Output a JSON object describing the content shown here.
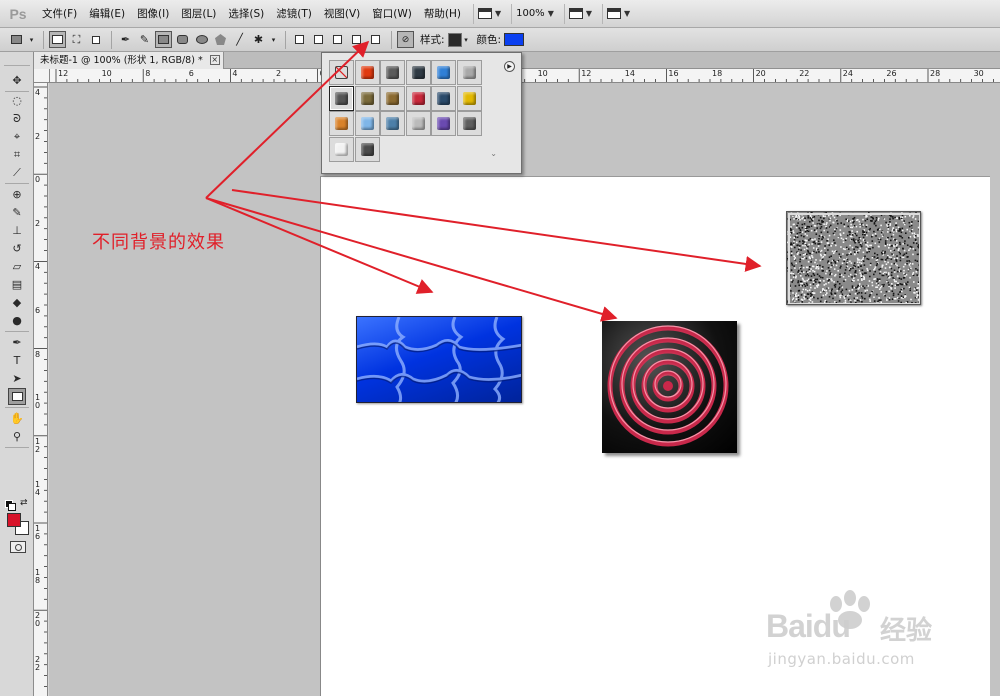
{
  "app": {
    "logo": "Ps"
  },
  "menu": [
    "文件(F)",
    "编辑(E)",
    "图像(I)",
    "图层(L)",
    "选择(S)",
    "滤镜(T)",
    "视图(V)",
    "窗口(W)",
    "帮助(H)"
  ],
  "menubar_controls": {
    "zoom": "100%"
  },
  "options_bar": {
    "style_label": "样式:",
    "color_label": "颜色:",
    "fill_color": "#0a3ff0",
    "style_swatch_color": "#2a2a2a"
  },
  "document_tab": {
    "title": "未标题-1 @ 100% (形状 1, RGB/8) *",
    "close": "×"
  },
  "ruler_top_labels": [
    "12",
    "10",
    "8",
    "6",
    "4",
    "2",
    "0",
    "2",
    "4",
    "6",
    "8",
    "10",
    "12",
    "14",
    "16",
    "18",
    "20",
    "22",
    "24",
    "26",
    "28",
    "30"
  ],
  "ruler_left_labels": [
    "4",
    "2",
    "0",
    "2",
    "4",
    "6",
    "8",
    "1 0",
    "1 2",
    "1 4",
    "1 6",
    "1 8",
    "2 0",
    "2 2"
  ],
  "tools": {
    "foreground_color": "#d8132a",
    "background_color": "#ffffff",
    "items": [
      "move-icon",
      "marquee-icon",
      "lasso-icon",
      "quick-select-icon",
      "crop-icon",
      "eyedropper-icon",
      "healing-brush-icon",
      "brush-icon",
      "clone-stamp-icon",
      "history-brush-icon",
      "eraser-icon",
      "gradient-icon",
      "blur-icon",
      "dodge-icon",
      "pen-icon",
      "type-icon",
      "path-select-icon",
      "rectangle-icon",
      "hand-icon",
      "zoom-icon"
    ]
  },
  "style_panel": {
    "swatches": [
      {
        "name": "none",
        "color": "transparent"
      },
      {
        "name": "red-glow",
        "color": "#e03a10"
      },
      {
        "name": "gray-bevel",
        "color": "#5a5a5a"
      },
      {
        "name": "dark-sphere",
        "color": "#2f3a44"
      },
      {
        "name": "blue-glass",
        "color": "#2f7fd6"
      },
      {
        "name": "light-gray",
        "color": "#a8a8a8"
      },
      {
        "name": "metal-gradient",
        "color": "#555555"
      },
      {
        "name": "bronze",
        "color": "#7a6a3a"
      },
      {
        "name": "gold-brown",
        "color": "#8b6a30"
      },
      {
        "name": "red-plastic",
        "color": "#c8283a"
      },
      {
        "name": "multicolor",
        "color": "#2a4a6a"
      },
      {
        "name": "yellow-gold",
        "color": "#e2b800"
      },
      {
        "name": "orange-sunset",
        "color": "#d9822a"
      },
      {
        "name": "sky-blue",
        "color": "#7fb6e8"
      },
      {
        "name": "landscape",
        "color": "#4d7fa8"
      },
      {
        "name": "frame-gray",
        "color": "#bbbbbb"
      },
      {
        "name": "purple-glass",
        "color": "#6a4ab0"
      },
      {
        "name": "dark-gray",
        "color": "#5e5e5e"
      },
      {
        "name": "white-outline",
        "color": "#f2f2f2"
      },
      {
        "name": "charcoal",
        "color": "#4a4a4a"
      }
    ]
  },
  "annotation": {
    "text": "不同背景的效果",
    "color": "#e0202a"
  },
  "watermark": {
    "brand": "Baidu",
    "cn": "经验",
    "url": "jingyan.baidu.com"
  }
}
